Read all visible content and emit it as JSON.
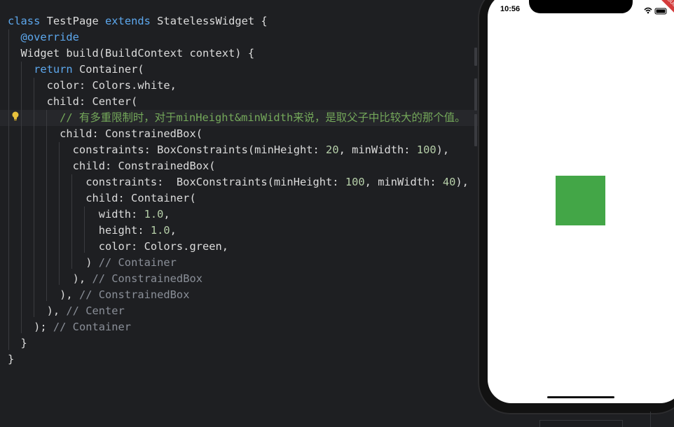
{
  "editor": {
    "lines": [
      [
        {
          "t": "class ",
          "c": "kw"
        },
        {
          "t": "TestPage ",
          "c": "plain"
        },
        {
          "t": "extends ",
          "c": "kw"
        },
        {
          "t": "StatelessWidget {",
          "c": "plain"
        }
      ],
      [
        {
          "t": "  ",
          "c": "plain"
        },
        {
          "t": "@override",
          "c": "anno"
        }
      ],
      [
        {
          "t": "  Widget build(BuildContext context) {",
          "c": "plain"
        }
      ],
      [
        {
          "t": "    ",
          "c": "plain"
        },
        {
          "t": "return ",
          "c": "kw"
        },
        {
          "t": "Container(",
          "c": "plain"
        }
      ],
      [
        {
          "t": "      color: Colors.white,",
          "c": "plain"
        }
      ],
      [
        {
          "t": "      child: Center(",
          "c": "plain"
        }
      ],
      [
        {
          "t": "        // 有多重限制时，对于minHeight&minWidth来说，是取父子中比较大的那个值。",
          "c": "cmt-green"
        }
      ],
      [
        {
          "t": "        child: ConstrainedBox(",
          "c": "plain"
        }
      ],
      [
        {
          "t": "          constraints: BoxConstraints(minHeight: ",
          "c": "plain"
        },
        {
          "t": "20",
          "c": "num"
        },
        {
          "t": ", minWidth: ",
          "c": "plain"
        },
        {
          "t": "100",
          "c": "num"
        },
        {
          "t": "),",
          "c": "plain"
        }
      ],
      [
        {
          "t": "          child: ConstrainedBox(",
          "c": "plain"
        }
      ],
      [
        {
          "t": "            constraints:  BoxConstraints(minHeight: ",
          "c": "plain"
        },
        {
          "t": "100",
          "c": "num"
        },
        {
          "t": ", minWidth: ",
          "c": "plain"
        },
        {
          "t": "40",
          "c": "num"
        },
        {
          "t": "),",
          "c": "plain"
        }
      ],
      [
        {
          "t": "            child: Container(",
          "c": "plain"
        }
      ],
      [
        {
          "t": "              width: ",
          "c": "plain"
        },
        {
          "t": "1.0",
          "c": "num"
        },
        {
          "t": ",",
          "c": "plain"
        }
      ],
      [
        {
          "t": "              height: ",
          "c": "plain"
        },
        {
          "t": "1.0",
          "c": "num"
        },
        {
          "t": ",",
          "c": "plain"
        }
      ],
      [
        {
          "t": "              color: Colors.green,",
          "c": "plain"
        }
      ],
      [
        {
          "t": "            ) ",
          "c": "plain"
        },
        {
          "t": "// Container",
          "c": "cmt"
        }
      ],
      [
        {
          "t": "          ), ",
          "c": "plain"
        },
        {
          "t": "// ConstrainedBox",
          "c": "cmt"
        }
      ],
      [
        {
          "t": "        ), ",
          "c": "plain"
        },
        {
          "t": "// ConstrainedBox",
          "c": "cmt"
        }
      ],
      [
        {
          "t": "      ), ",
          "c": "plain"
        },
        {
          "t": "// Center",
          "c": "cmt"
        }
      ],
      [
        {
          "t": "    ); ",
          "c": "plain"
        },
        {
          "t": "// Container",
          "c": "cmt"
        }
      ],
      [
        {
          "t": "  }",
          "c": "plain"
        }
      ],
      [
        {
          "t": "}",
          "c": "plain"
        }
      ]
    ],
    "active_line": 6,
    "gutter_icon": "lightbulb-icon"
  },
  "simulator": {
    "status_time": "10:56",
    "status_icons": [
      "wifi-icon",
      "battery-icon"
    ],
    "debug_banner": "DEBUG",
    "box_color": "#43a647"
  },
  "colors": {
    "background": "#1e1f22",
    "keyword": "#5da8ee",
    "number": "#b5cea8",
    "comment": "#8a8f98",
    "comment_cjk": "#74a85a"
  }
}
